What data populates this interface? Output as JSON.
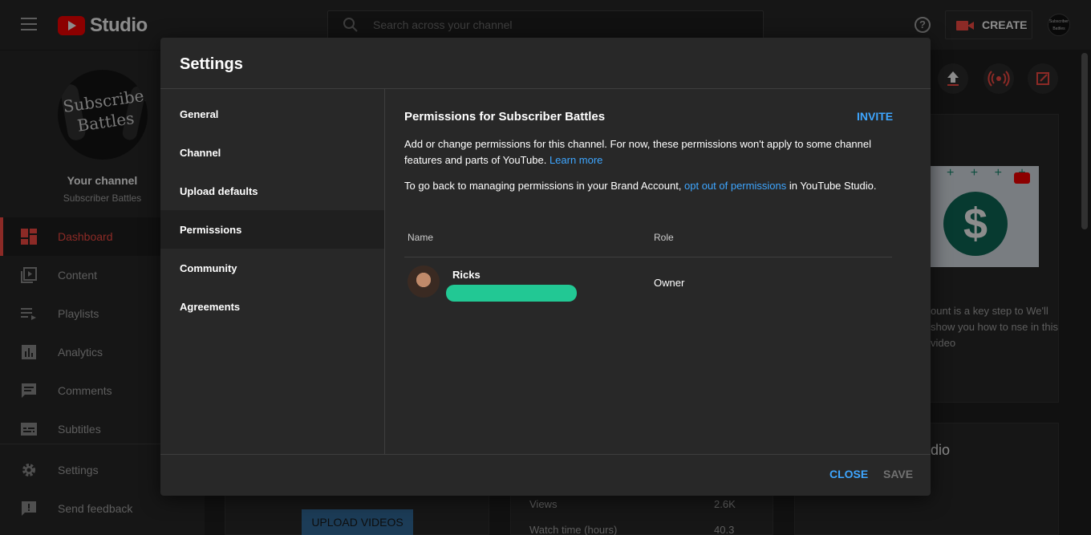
{
  "topbar": {
    "logo_text": "Studio",
    "search_placeholder": "Search across your channel",
    "help": "?",
    "create_label": "CREATE",
    "avatar_text": "Subscriber Battles"
  },
  "sidenav": {
    "avatar_text": "Subscriber Battles",
    "your_channel": "Your channel",
    "channel_name": "Subscriber Battles",
    "items": [
      {
        "label": "Dashboard",
        "icon": "dashboard-icon"
      },
      {
        "label": "Content",
        "icon": "content-icon"
      },
      {
        "label": "Playlists",
        "icon": "playlists-icon"
      },
      {
        "label": "Analytics",
        "icon": "analytics-icon"
      },
      {
        "label": "Comments",
        "icon": "comments-icon"
      },
      {
        "label": "Subtitles",
        "icon": "subtitles-icon"
      },
      {
        "label": "Settings",
        "icon": "settings-icon"
      },
      {
        "label": "Send feedback",
        "icon": "feedback-icon"
      }
    ]
  },
  "dashboard_bg": {
    "promo_text": "ount is a key step to We'll show you how to nse in this video",
    "card2_title": "dio",
    "upload_videos": "UPLOAD VIDEOS",
    "stats": [
      {
        "label": "Views",
        "value": "2.6K"
      },
      {
        "label": "Watch time (hours)",
        "value": "40.3"
      }
    ]
  },
  "dialog": {
    "title": "Settings",
    "menu": [
      {
        "label": "General"
      },
      {
        "label": "Channel"
      },
      {
        "label": "Upload defaults"
      },
      {
        "label": "Permissions"
      },
      {
        "label": "Community"
      },
      {
        "label": "Agreements"
      }
    ],
    "active_menu": "Permissions",
    "permissions": {
      "title": "Permissions for Subscriber Battles",
      "invite": "INVITE",
      "desc_1": "Add or change permissions for this channel. For now, these permissions won't apply to some channel features and parts of YouTube. ",
      "learn_more": "Learn more",
      "back_1": "To go back to managing permissions in your Brand Account, ",
      "back_link": "opt out of permissions",
      "back_2": " in YouTube Studio.",
      "col_name": "Name",
      "col_role": "Role",
      "rows": [
        {
          "name": "Ricks",
          "role": "Owner"
        }
      ]
    },
    "close": "CLOSE",
    "save": "SAVE"
  },
  "colors": {
    "accent": "#3ea6ff",
    "brand_red": "#ff4e45",
    "redaction": "#22c894"
  }
}
